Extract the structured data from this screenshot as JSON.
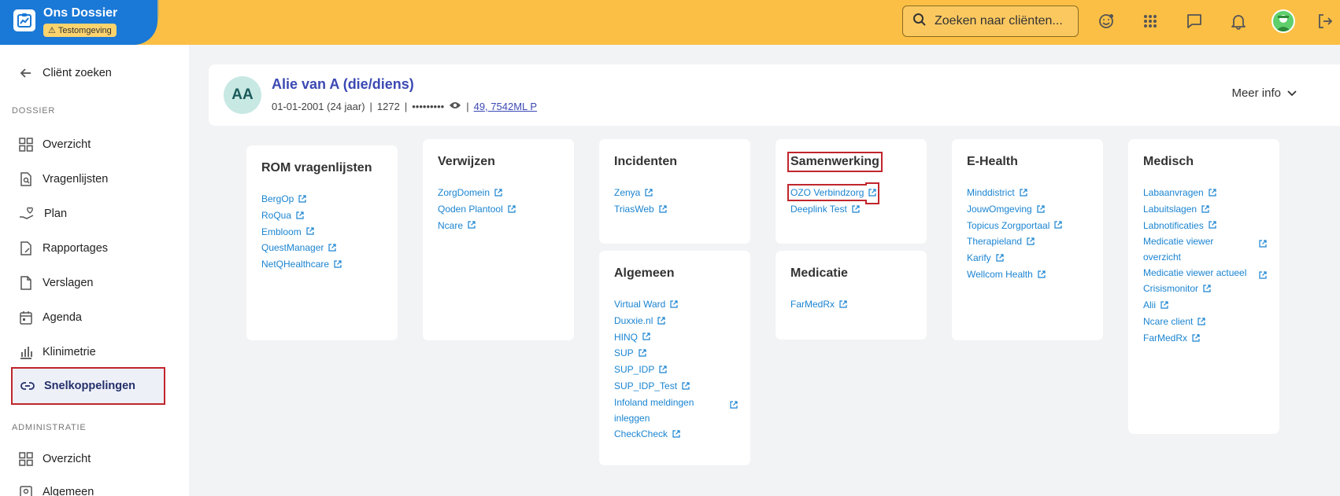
{
  "header": {
    "app_title": "Ons Dossier",
    "env_badge": "Testomgeving",
    "search_placeholder": "Zoeken naar cliënten..."
  },
  "sidebar": {
    "back_label": "Cliënt zoeken",
    "section_dossier": "DOSSIER",
    "items": [
      {
        "label": "Overzicht"
      },
      {
        "label": "Vragenlijsten"
      },
      {
        "label": "Plan"
      },
      {
        "label": "Rapportages"
      },
      {
        "label": "Verslagen"
      },
      {
        "label": "Agenda"
      },
      {
        "label": "Klinimetrie"
      },
      {
        "label": "Snelkoppelingen"
      }
    ],
    "section_admin": "ADMINISTRATIE",
    "admin_items": [
      {
        "label": "Overzicht"
      },
      {
        "label": "Algemeen"
      }
    ]
  },
  "client": {
    "initials": "AA",
    "name": "Alie van A (die/diens)",
    "dob": "01-01-2001 (24 jaar)",
    "sep1": "|",
    "id": "1272",
    "sep2": "|",
    "masked": "•••••••••",
    "sep3": "|",
    "address": " 49, 7542ML P",
    "meer_info": "Meer info"
  },
  "cards": {
    "rom": {
      "title": "ROM vragenlijsten",
      "links": [
        "BergOp",
        "RoQua",
        "Embloom",
        "QuestManager",
        "NetQHealthcare"
      ]
    },
    "verwijzen": {
      "title": "Verwijzen",
      "links": [
        "ZorgDomein",
        "Qoden Plantool",
        "Ncare"
      ]
    },
    "incidenten": {
      "title": "Incidenten",
      "links": [
        "Zenya",
        "TriasWeb"
      ]
    },
    "algemeen": {
      "title": "Algemeen",
      "links": [
        "Virtual Ward",
        "Duxxie.nl",
        "HINQ",
        "SUP",
        "SUP_IDP",
        "SUP_IDP_Test",
        "Infoland meldingen inleggen",
        "CheckCheck"
      ]
    },
    "samenwerking": {
      "title": "Samenwerking",
      "links": [
        "OZO Verbindzorg",
        "Deeplink Test"
      ]
    },
    "medicatie": {
      "title": "Medicatie",
      "links": [
        "FarMedRx"
      ]
    },
    "ehealth": {
      "title": "E-Health",
      "links": [
        "Minddistrict",
        "JouwOmgeving",
        "Topicus Zorgportaal",
        "Therapieland",
        "Karify",
        "Wellcom Health"
      ]
    },
    "medisch": {
      "title": "Medisch",
      "links": [
        "Labaanvragen",
        "Labuitslagen",
        "Labnotificaties",
        "Medicatie viewer overzicht",
        "Medicatie viewer actueel",
        "Crisismonitor",
        "Alii",
        "Ncare client",
        "FarMedRx"
      ]
    }
  },
  "colors": {
    "header_bg": "#fbbf45",
    "brand_blue": "#1a78d6",
    "link_blue": "#1a84d1",
    "highlight_red": "#c0262c",
    "client_name": "#3b49b3"
  }
}
